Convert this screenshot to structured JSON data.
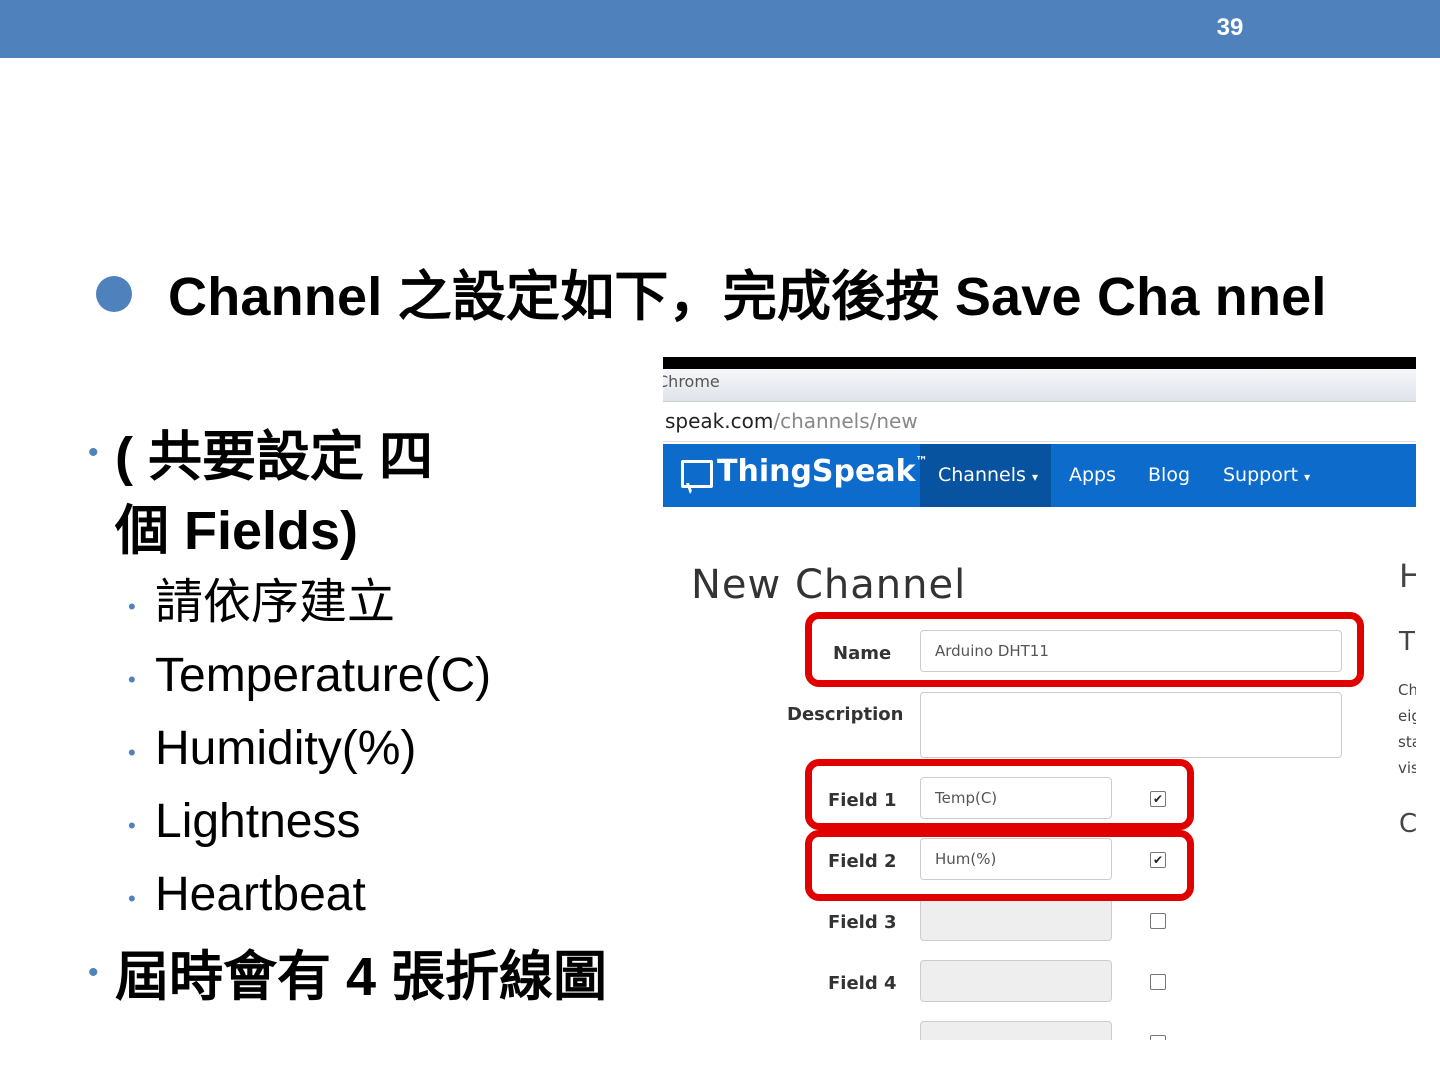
{
  "slide": {
    "page_number": "39",
    "heading": "Channel  之設定如下，完成後按 Save Cha nnel",
    "bullets": [
      {
        "text": "( 共要設定 四個 Fields)"
      },
      {
        "text": "請依序建立"
      },
      {
        "text": "Temperature(C)"
      },
      {
        "text": "Humidity(%)"
      },
      {
        "text": "Lightness"
      },
      {
        "text": "Heartbeat"
      },
      {
        "text": "屆時會有 4 張折線圖"
      }
    ],
    "bullet_color": "#4f81bd"
  },
  "screenshot": {
    "browser_label": "Chrome",
    "url_host": "speak.com",
    "url_path": "/channels/new",
    "logo": "ThingSpeak",
    "logo_tm": "™",
    "nav": [
      "Channels",
      "Apps",
      "Blog",
      "Support"
    ],
    "page_title": "New Channel",
    "form": {
      "name_label": "Name",
      "name_value": "Arduino DHT11",
      "description_label": "Description",
      "fields": [
        {
          "label": "Field 1",
          "value": "Temp(C)",
          "checked": true
        },
        {
          "label": "Field 2",
          "value": "Hum(%)",
          "checked": true
        },
        {
          "label": "Field 3",
          "value": "",
          "checked": false
        },
        {
          "label": "Field 4",
          "value": "",
          "checked": false
        }
      ]
    },
    "side_fragments": [
      "H",
      "T",
      "Ch",
      "eig",
      "sta",
      "vis",
      "C"
    ],
    "highlight_color": "#e00000",
    "nav_color": "#0d6bcc"
  }
}
